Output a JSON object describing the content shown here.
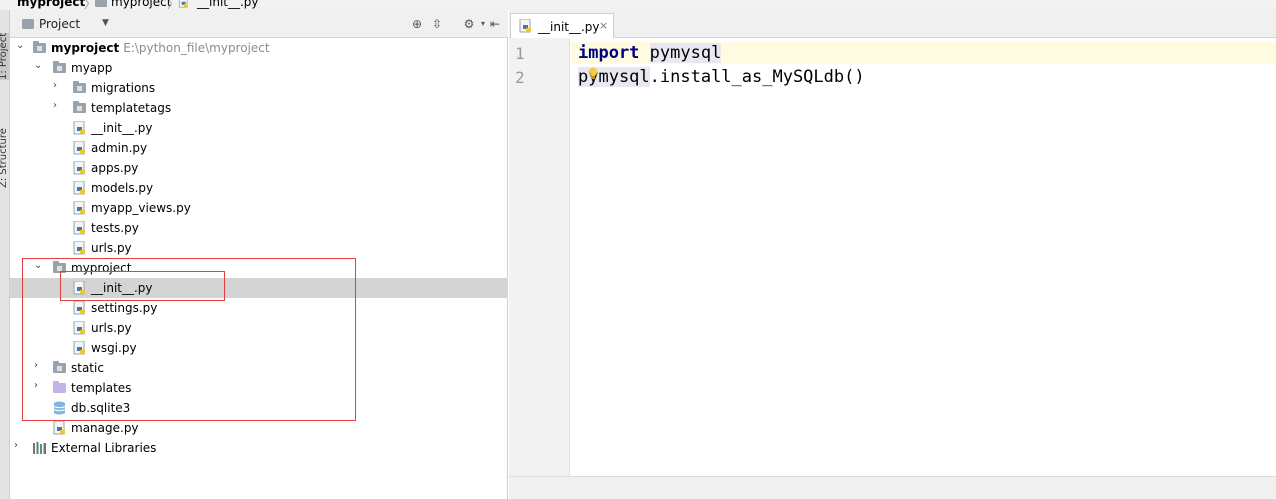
{
  "breadcrumb": {
    "root": "myproject",
    "folder": "myproject",
    "file": "__init__.py"
  },
  "sidebar_tabs": {
    "project": "1: Project",
    "structure": "Z: Structure"
  },
  "panel": {
    "title": "Project",
    "toolbar_icons": [
      "target-icon",
      "collapse-icon",
      "gear-icon",
      "hide-icon"
    ]
  },
  "tree": [
    {
      "label": "myproject",
      "path": "E:\\python_file\\myproject",
      "kind": "folder",
      "expanded": true
    },
    {
      "label": "myapp",
      "kind": "folder",
      "expanded": true
    },
    {
      "label": "migrations",
      "kind": "folder",
      "expanded": false
    },
    {
      "label": "templatetags",
      "kind": "folder",
      "expanded": false
    },
    {
      "label": "__init__.py",
      "kind": "python"
    },
    {
      "label": "admin.py",
      "kind": "python"
    },
    {
      "label": "apps.py",
      "kind": "python"
    },
    {
      "label": "models.py",
      "kind": "python"
    },
    {
      "label": "myapp_views.py",
      "kind": "python"
    },
    {
      "label": "tests.py",
      "kind": "python"
    },
    {
      "label": "urls.py",
      "kind": "python"
    },
    {
      "label": "myproject",
      "kind": "folder",
      "expanded": true
    },
    {
      "label": "__init__.py",
      "kind": "python",
      "selected": true
    },
    {
      "label": "settings.py",
      "kind": "python"
    },
    {
      "label": "urls.py",
      "kind": "python"
    },
    {
      "label": "wsgi.py",
      "kind": "python"
    },
    {
      "label": "static",
      "kind": "folder",
      "expanded": false
    },
    {
      "label": "templates",
      "kind": "template-folder",
      "expanded": false
    },
    {
      "label": "db.sqlite3",
      "kind": "database"
    },
    {
      "label": "manage.py",
      "kind": "python"
    },
    {
      "label": "External Libraries",
      "kind": "library",
      "expanded": false
    }
  ],
  "editor": {
    "tab_label": "__init__.py",
    "line_numbers": [
      "1",
      "2"
    ],
    "lines": [
      {
        "keyword": "import",
        "rest": "pymysql"
      },
      {
        "module": "pymysql",
        "rest": ".install_as_MySQLdb()"
      }
    ]
  },
  "colors": {
    "selection": "#d4d4d4",
    "annotation_box": "#e04040",
    "keyword": "#000080",
    "current_line": "#fffbe0"
  }
}
